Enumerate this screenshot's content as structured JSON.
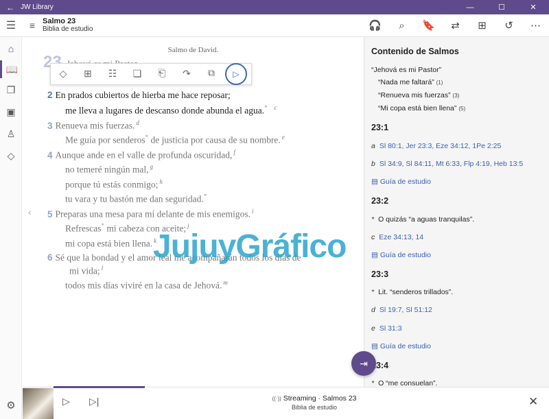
{
  "window": {
    "app_name": "JW Library",
    "back": "←",
    "minimize": "—",
    "maximize": "☐",
    "close": "✕"
  },
  "header": {
    "menu_icon": "☰",
    "list_icon": "≡",
    "title": "Salmo 23",
    "subtitle": "Biblia de estudio",
    "toolbar": {
      "audio": "🎧",
      "search": "⌕",
      "bookmark": "🔖",
      "translate": "⇄",
      "add_note": "⊞",
      "history": "↺",
      "more": "⋯"
    }
  },
  "leftnav": [
    {
      "name": "home-icon",
      "glyph": "⌂"
    },
    {
      "name": "bible-icon",
      "glyph": "📖"
    },
    {
      "name": "publications-icon",
      "glyph": "❐"
    },
    {
      "name": "media-icon",
      "glyph": "▣"
    },
    {
      "name": "meetings-icon",
      "glyph": "♙"
    },
    {
      "name": "personal-study-icon",
      "glyph": "◇"
    }
  ],
  "settings_icon": "⚙",
  "reader": {
    "superscription": "Salmo de David.",
    "chapter": "23",
    "verse1_ghost": "Jehová es mi Pastor.",
    "popup": {
      "highlight": "◇",
      "note": "⊞",
      "compare": "☷",
      "copy_text": "❏",
      "bookmark": "⎗",
      "share": "↷",
      "copy": "⧉",
      "play": "▷"
    },
    "verses": {
      "v2_num": "2",
      "v2_l1": "En prados cubiertos de hierba me hace reposar;",
      "v2_l2": "me lleva a lugares de descanso donde abunda el agua.",
      "v2_l2_ast": "*",
      "v2_l2_fn": "c",
      "v3_num": "3",
      "v3_l1": "Renueva mis fuerzas.",
      "v3_l1_fn": "d",
      "v3_l2a": "Me guía por senderos",
      "v3_l2_ast": "*",
      "v3_l2b": " de justicia por causa de su nombre.",
      "v3_l2_fn": "e",
      "v4_num": "4",
      "v4_l1": "Aunque ande en el valle de profunda oscuridad,",
      "v4_l1_fn": "f",
      "v4_l2": "no temeré ningún mal,",
      "v4_l2_fn": "g",
      "v4_l3": "porque tú estás conmigo;",
      "v4_l3_fn": "h",
      "v4_l4": "tu vara y tu bastón me dan seguridad.",
      "v4_l4_ast": "*",
      "v5_num": "5",
      "v5_l1": "Preparas una mesa para mí delante de mis enemigos.",
      "v5_l1_fn": "i",
      "v5_l2a": "Refrescas",
      "v5_l2_ast": "*",
      "v5_l2b": " mi cabeza con aceite;",
      "v5_l2_fn": "j",
      "v5_l3": "mi copa está bien llena.",
      "v5_l3_fn": "k",
      "v6_num": "6",
      "v6_l1": "Sé que la bondad y el amor leal me acompañarán todos los días de",
      "v6_l2": "mi vida;",
      "v6_l2_fn": "l",
      "v6_l3": "todos mis días viviré en la casa de Jehová.",
      "v6_l3_fn": "m"
    },
    "prev_arrow": "‹",
    "watermark": "JujuyGráfico"
  },
  "sidepanel": {
    "title": "Contenido de Salmos",
    "toc": [
      {
        "text": "“Jehová es mi Pastor”",
        "count": ""
      },
      {
        "text": "“Nada me faltará”",
        "count": "(1)"
      },
      {
        "text": "“Renueva mis fuerzas”",
        "count": "(3)"
      },
      {
        "text": "“Mi copa está bien llena”",
        "count": "(5)"
      }
    ],
    "s231": {
      "head": "23:1",
      "a_letter": "a",
      "a_refs": "Sl 80:1, Jer 23:3, Eze 34:12, 1Pe 2:25",
      "b_letter": "b",
      "b_refs": "Sl 34:9, Sl 84:11, Mt 6:33, Flp 4:19, Heb 13:5",
      "guide": "Guía de estudio"
    },
    "s232": {
      "head": "23:2",
      "ast": "*",
      "note": "O quizás “a aguas tranquilas”.",
      "c_letter": "c",
      "c_refs": "Eze 34:13, 14",
      "guide": "Guía de estudio"
    },
    "s233": {
      "head": "23:3",
      "ast": "*",
      "note": "Lit. “senderos trillados”.",
      "d_letter": "d",
      "d_refs": "Sl 19:7, Sl 51:12",
      "e_letter": "e",
      "e_refs": "Sl 31:3",
      "guide": "Guía de estudio"
    },
    "s234": {
      "head": "23:4",
      "ast": "*",
      "note": "O “me consuelan”."
    },
    "guide_icon": "▤"
  },
  "fab_icon": "⇥",
  "player": {
    "play": "▷",
    "next": "▷|",
    "title": "Streaming · Salmos 23",
    "streaming_icon": "((·))",
    "subtitle": "Biblia de estudio",
    "close": "✕"
  }
}
